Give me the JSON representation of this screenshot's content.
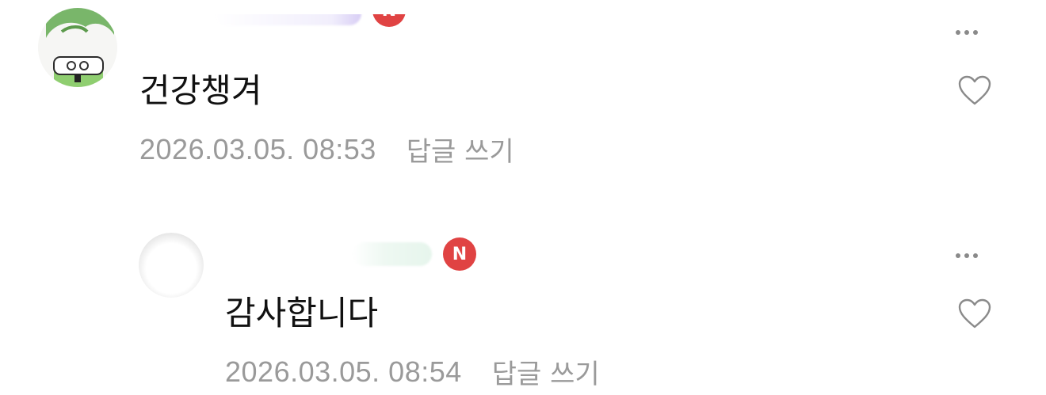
{
  "comments": [
    {
      "text": "건강챙겨",
      "date": "2026.03.05. 08:53",
      "reply_label": "답글 쓰기",
      "badge": "N"
    },
    {
      "text": "감사합니다",
      "date": "2026.03.05. 08:54",
      "reply_label": "답글 쓰기",
      "badge": "N"
    }
  ],
  "colors": {
    "badge": "#e04343",
    "meta_text": "#9a9a9a",
    "icon": "#8a8a8a"
  },
  "icons": [
    "more-options-icon",
    "heart-icon",
    "avatar-image"
  ]
}
